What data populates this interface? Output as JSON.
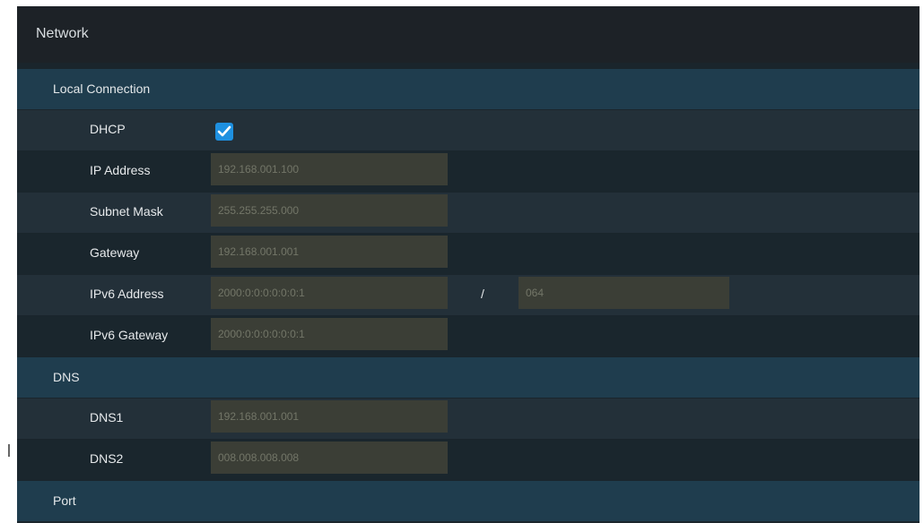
{
  "window": {
    "title": "Network"
  },
  "local_connection": {
    "heading": "Local Connection",
    "dhcp": {
      "label": "DHCP",
      "checked": true,
      "icon": "checkmark-icon",
      "accent": "#1e90e0"
    },
    "ip_address": {
      "label": "IP Address",
      "value": "192.168.001.100"
    },
    "subnet_mask": {
      "label": "Subnet Mask",
      "value": "255.255.255.000"
    },
    "gateway": {
      "label": "Gateway",
      "value": "192.168.001.001"
    },
    "ipv6_address": {
      "label": "IPv6 Address",
      "value": "2000:0:0:0:0:0:0:1",
      "separator": "/",
      "prefix": "064"
    },
    "ipv6_gateway": {
      "label": "IPv6 Gateway",
      "value": "2000:0:0:0:0:0:0:1"
    }
  },
  "dns": {
    "heading": "DNS",
    "dns1": {
      "label": "DNS1",
      "value": "192.168.001.001"
    },
    "dns2": {
      "label": "DNS2",
      "value": "008.008.008.008"
    }
  },
  "port": {
    "heading": "Port"
  }
}
